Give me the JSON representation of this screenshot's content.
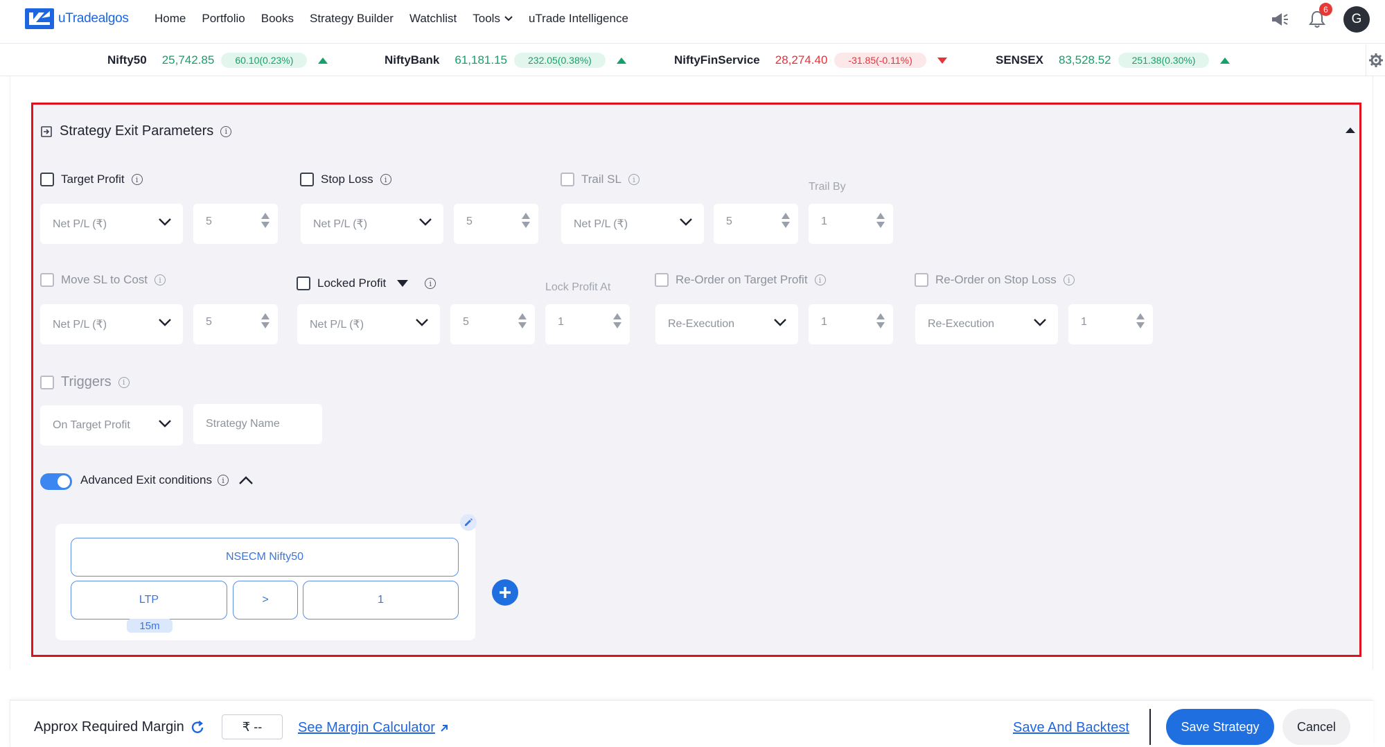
{
  "brand": {
    "name_part1": "uTrade",
    "name_part2": "algos",
    "accent": "#1e66e0"
  },
  "nav": {
    "items": [
      {
        "label": "Home"
      },
      {
        "label": "Portfolio"
      },
      {
        "label": "Books"
      },
      {
        "label": "Strategy Builder"
      },
      {
        "label": "Watchlist"
      },
      {
        "label": "Tools"
      },
      {
        "label": "uTrade Intelligence"
      }
    ],
    "notification_count": "6",
    "avatar_initial": "G"
  },
  "ticker": [
    {
      "name": "Nifty50",
      "price": "25,742.85",
      "change": "60.10(0.23%)",
      "direction": "up"
    },
    {
      "name": "NiftyBank",
      "price": "61,181.15",
      "change": "232.05(0.38%)",
      "direction": "up"
    },
    {
      "name": "NiftyFinService",
      "price": "28,274.40",
      "change": "-31.85(-0.11%)",
      "direction": "down"
    },
    {
      "name": "SENSEX",
      "price": "83,528.52",
      "change": "251.38(0.30%)",
      "direction": "up"
    }
  ],
  "panel": {
    "title": "Strategy Exit Parameters",
    "target_profit": {
      "label": "Target Profit",
      "type": "Net P/L (₹)",
      "value": "5"
    },
    "stop_loss": {
      "label": "Stop Loss",
      "type": "Net P/L (₹)",
      "value": "5"
    },
    "trail_sl": {
      "label": "Trail SL",
      "type": "Net P/L (₹)",
      "value": "5",
      "trail_by_label": "Trail By",
      "trail_by_value": "1"
    },
    "move_sl": {
      "label": "Move SL to Cost",
      "type": "Net P/L (₹)",
      "value": "5"
    },
    "locked_profit": {
      "label": "Locked Profit",
      "type": "Net P/L (₹)",
      "value": "5",
      "lock_at_label": "Lock Profit At",
      "lock_at_value": "1"
    },
    "reorder_target": {
      "label": "Re-Order on Target Profit",
      "type": "Re-Execution",
      "value": "1"
    },
    "reorder_stop": {
      "label": "Re-Order on Stop Loss",
      "type": "Re-Execution",
      "value": "1"
    },
    "triggers": {
      "label": "Triggers",
      "type": "On Target Profit",
      "strategy_placeholder": "Strategy Name"
    },
    "advanced": {
      "label": "Advanced Exit conditions",
      "enabled": true
    },
    "condition": {
      "instrument": "NSECM Nifty50",
      "field": "LTP",
      "interval": "15m",
      "operator": ">",
      "value": "1"
    }
  },
  "footer": {
    "margin_label": "Approx Required Margin",
    "margin_value": "₹ --",
    "calc_link": "See Margin Calculator",
    "backtest_link": "Save And Backtest",
    "save_label": "Save Strategy",
    "cancel_label": "Cancel"
  }
}
